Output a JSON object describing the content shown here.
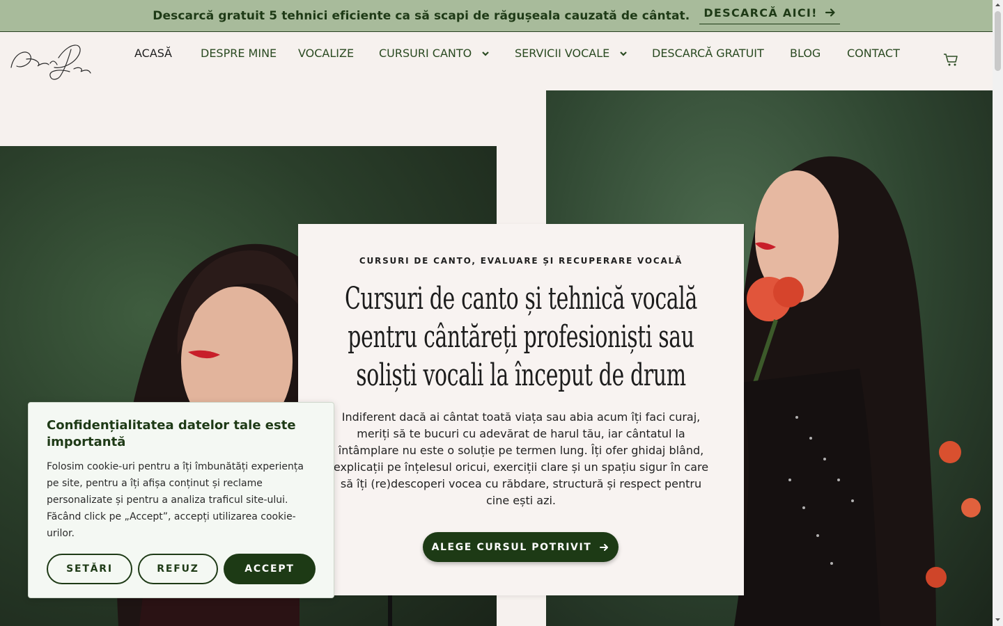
{
  "promo": {
    "text": "Descarcă gratuit 5 tehnici eficiente ca să scapi de răgușeala cauzată de cântat.",
    "link_label": "DESCARCĂ AICI!"
  },
  "header": {
    "logo_name": "Andra Dan Artist",
    "nav": [
      {
        "label": "ACASĂ",
        "active": true
      },
      {
        "label": "DESPRE MINE"
      },
      {
        "label": "VOCALIZE"
      },
      {
        "label": "CURSURI CANTO",
        "has_dropdown": true
      },
      {
        "label": "SERVICII VOCALE",
        "has_dropdown": true
      },
      {
        "label": "DESCARCĂ GRATUIT"
      },
      {
        "label": "BLOG"
      },
      {
        "label": "CONTACT"
      }
    ],
    "cart_icon": "cart-icon"
  },
  "hero": {
    "eyebrow": "CURSURI DE CANTO, EVALUARE ȘI RECUPERARE VOCALĂ",
    "title": "Cursuri de canto și tehnică vocală pentru cântăreți profesioniști sau soliști vocali la început de drum",
    "description": "Indiferent dacă ai cântat toată viața sau abia acum îți faci curaj, meriți să te bucuri cu adevărat de harul tău, iar cântatul la întâmplare nu este o soluție pe termen lung. Îți ofer ghidaj blând, explicații pe înțelesul oricui, exerciții clare și un spațiu sigur în care să îți (re)descoperi vocea cu răbdare, structură și respect pentru cine ești azi.",
    "cta_label": "ALEGE CURSUL POTRIVIT"
  },
  "cookie": {
    "title": "Confidențialitatea datelor tale este importantă",
    "text": "Folosim cookie-uri pentru a îți îmbunătăți experiența pe site, pentru a îți afișa conținut și reclame personalizate și pentru a analiza traficul site-ului. Făcând click pe „Accept”, accepți utilizarea cookie-urilor.",
    "settings_label": "SETĂRI",
    "refuse_label": "REFUZ",
    "accept_label": "ACCEPT"
  },
  "colors": {
    "promo_bg": "#a8bb9b",
    "brand_green": "#1d3a15",
    "nav_text": "#2a4a21",
    "page_bg": "#f6f1ee"
  }
}
